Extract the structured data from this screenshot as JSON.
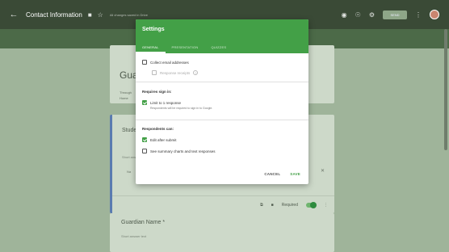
{
  "topbar": {
    "title": "Contact Information",
    "saved_status": "All changes saved in Drive",
    "send_label": "SEND"
  },
  "form": {
    "title": "Guar",
    "desc_line1": "Through",
    "desc_line2": "Home",
    "question_label": "Stude",
    "question_sub": "Short answer text",
    "na_label": "Na",
    "required_label": "Required",
    "guardian_label": "Guardian Name",
    "guardian_required_mark": "*",
    "guardian_sub": "Short answer text"
  },
  "dialog": {
    "title": "Settings",
    "tabs": [
      "GENERAL",
      "PRESENTATION",
      "QUIZZES"
    ],
    "collect_email": "Collect email addresses",
    "response_receipts": "Response receipts",
    "requires_sign_in": "Requires sign in:",
    "limit_one": "Limit to 1 response",
    "limit_one_sub": "Respondents will be required to sign in to Google.",
    "respondents_can": "Respondents can:",
    "edit_after": "Edit after submit",
    "see_summary": "See summary charts and text responses",
    "cancel_label": "CANCEL",
    "save_label": "SAVE"
  },
  "colors": {
    "accent": "#43a047",
    "topbar": "#3a4a36"
  },
  "icons": [
    "back-arrow-icon",
    "folder-icon",
    "star-icon",
    "palette-icon",
    "eye-icon",
    "gear-icon",
    "more-vert-icon",
    "help-icon",
    "copy-icon",
    "trash-icon",
    "close-icon"
  ]
}
